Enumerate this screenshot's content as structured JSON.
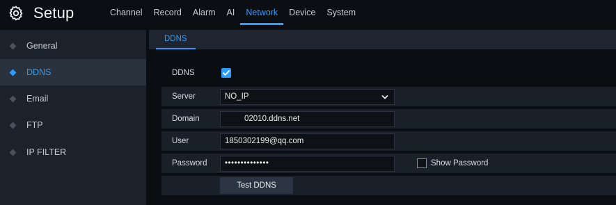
{
  "app": {
    "title": "Setup",
    "icon": "gear-icon"
  },
  "tabs": [
    {
      "label": "Channel",
      "active": false
    },
    {
      "label": "Record",
      "active": false
    },
    {
      "label": "Alarm",
      "active": false
    },
    {
      "label": "AI",
      "active": false
    },
    {
      "label": "Network",
      "active": true
    },
    {
      "label": "Device",
      "active": false
    },
    {
      "label": "System",
      "active": false
    }
  ],
  "sidebar": {
    "items": [
      {
        "label": "General",
        "active": false
      },
      {
        "label": "DDNS",
        "active": true
      },
      {
        "label": "Email",
        "active": false
      },
      {
        "label": "FTP",
        "active": false
      },
      {
        "label": "IP FILTER",
        "active": false
      }
    ]
  },
  "subtab": {
    "label": "DDNS"
  },
  "form": {
    "ddns": {
      "label": "DDNS",
      "checked": true
    },
    "server": {
      "label": "Server",
      "value": "NO_IP"
    },
    "domain": {
      "label": "Domain",
      "value": "02010.ddns.net"
    },
    "user": {
      "label": "User",
      "value": "1850302199@qq.com"
    },
    "password": {
      "label": "Password",
      "value": "••••••••••••••"
    },
    "show_password": {
      "label": "Show Password",
      "checked": false
    },
    "test_button": {
      "label": "Test DDNS"
    }
  },
  "colors": {
    "accent": "#2d9cff",
    "sidebar_bg": "#1c222b",
    "page_bg": "#0a0d12"
  }
}
